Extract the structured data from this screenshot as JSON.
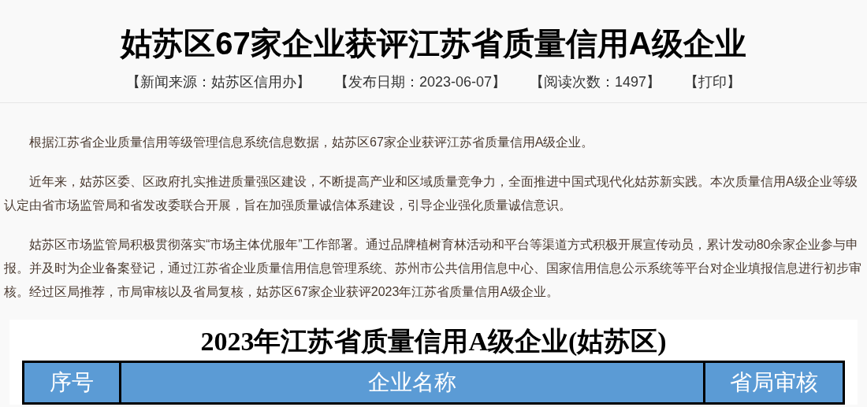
{
  "article": {
    "title": "姑苏区67家企业获评江苏省质量信用A级企业",
    "meta": [
      "【新闻来源：姑苏区信用办】",
      "【发布日期：2023-06-07】",
      "【阅读次数：1497】",
      "【打印】"
    ],
    "paragraphs": [
      "根据江苏省企业质量信用等级管理信息系统信息数据，姑苏区67家企业获评江苏省质量信用A级企业。",
      "近年来，姑苏区委、区政府扎实推进质量强区建设，不断提高产业和区域质量竞争力，全面推进中国式现代化姑苏新实践。本次质量信用A级企业等级认定由省市场监管局和省发改委联合开展，旨在加强质量诚信体系建设，引导企业强化质量诚信意识。",
      "姑苏区市场监管局积极贯彻落实“市场主体优服年”工作部署。通过品牌植树育林活动和平台等渠道方式积极开展宣传动员，累计发动80余家企业参与申报。并及时为企业备案登记，通过江苏省企业质量信用信息管理系统、苏州市公共信用信息中心、国家信用信息公示系统等平台对企业填报信息进行初步审核。经过区局推荐，市局审核以及省局复核，姑苏区67家企业获评2023年江苏省质量信用A级企业。"
    ],
    "table": {
      "title": "2023年江苏省质量信用A级企业(姑苏区)",
      "columns": [
        "序号",
        "企业名称",
        "省局审核"
      ]
    }
  }
}
